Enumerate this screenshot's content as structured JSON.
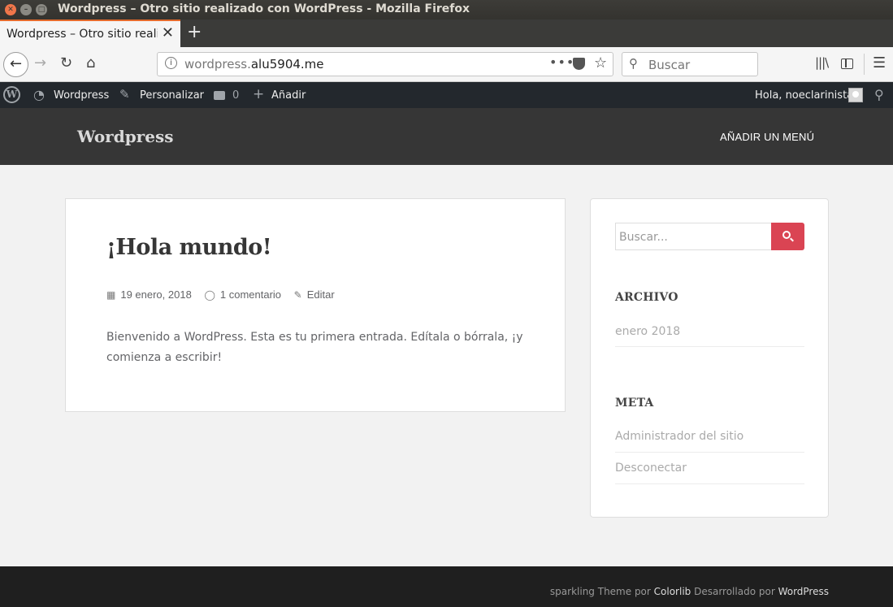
{
  "window": {
    "title": "Wordpress – Otro sitio realizado con WordPress - Mozilla Firefox"
  },
  "browser": {
    "tab_label": "Wordpress – Otro sitio reali",
    "url_prefix": "wordpress.",
    "url_domain": "alu5904.me",
    "search_placeholder": "Buscar",
    "icons": [
      "back-icon",
      "forward-icon",
      "reload-icon",
      "home-icon",
      "info-icon",
      "more-icon",
      "pocket-icon",
      "bookmark-star-icon",
      "search-icon",
      "library-icon",
      "sidebar-icon",
      "hamburger-menu-icon"
    ]
  },
  "adminbar": {
    "site_name": "Wordpress",
    "customize": "Personalizar",
    "comments_count": "0",
    "new": "Añadir",
    "howdy": "Hola, noeclarinista"
  },
  "site": {
    "title": "Wordpress",
    "menu_placeholder": "AÑADIR UN MENÚ"
  },
  "post": {
    "title": "¡Hola mundo!",
    "date": "19 enero, 2018",
    "comments": "1 comentario",
    "edit": "Editar",
    "body": "Bienvenido a WordPress. Esta es tu primera entrada. Edítala o bórrala, ¡y comienza a escribir!"
  },
  "sidebar": {
    "search_placeholder": "Buscar...",
    "archive_heading": "ARCHIVO",
    "archive_items": [
      "enero 2018"
    ],
    "meta_heading": "META",
    "meta_items": [
      "Administrador del sitio",
      "Desconectar"
    ]
  },
  "footer": {
    "theme_prefix": "sparkling Theme por ",
    "theme_author": "Colorlib",
    "developed_by": " Desarrollado por ",
    "platform": "WordPress"
  },
  "colors": {
    "accent": "#da4453",
    "header_bg": "#363636",
    "adminbar_bg": "#23282d",
    "footer_bg": "#1f1f1f",
    "tab_highlight": "#e56b2c"
  }
}
